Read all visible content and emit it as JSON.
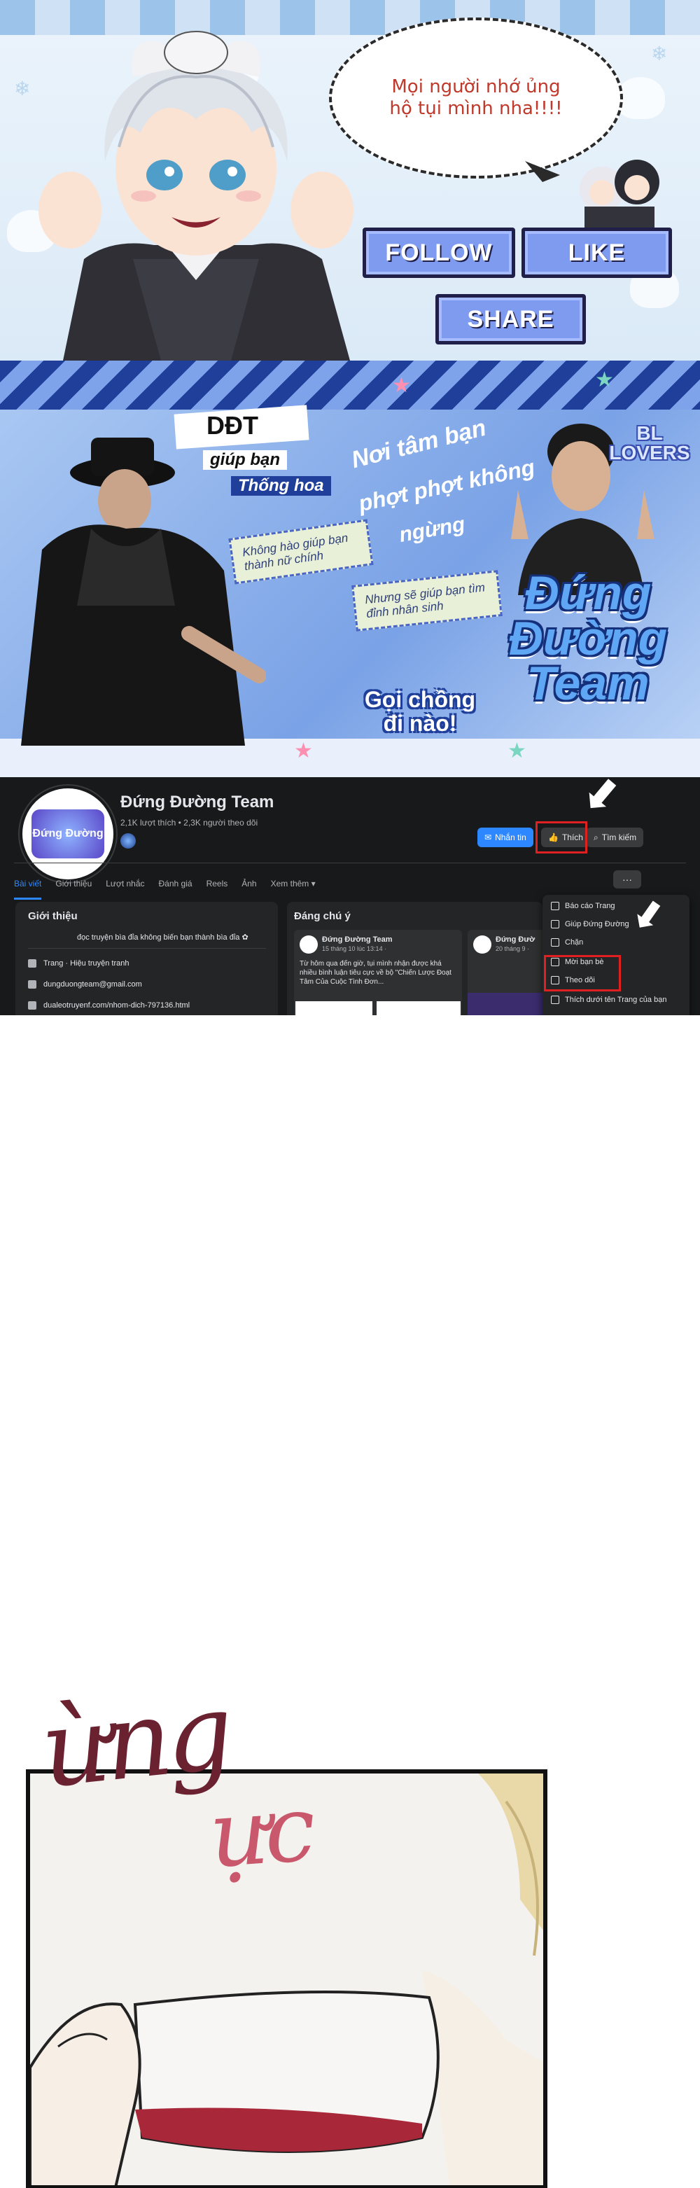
{
  "banner1": {
    "speech": "Mọi người nhớ ủng hộ tụi mình nha!!!!",
    "buttons": {
      "follow": "FOLLOW",
      "like": "LIKE",
      "share": "SHARE"
    }
  },
  "banner2": {
    "tag1": "DĐT",
    "tag2": "giúp bạn",
    "tag3": "Thống hoa",
    "script1": "Nơi tâm bạn",
    "script2": "phợt phợt không",
    "script3": "ngừng",
    "note1": "Không hào giúp bạn thành nữ chính",
    "note2": "Nhưng sẽ giúp bạn tìm đỉnh nhân sinh",
    "bl": "BL LOVERS",
    "title": "Đứng Đường Team",
    "call": "Gọi chồng đi nào!"
  },
  "fb": {
    "avatar_text": "Đứng Đường",
    "name": "Đứng Đường Team",
    "stats": "2,1K lượt thích • 2,3K người theo dõi",
    "buttons": {
      "message": "Nhắn tin",
      "like": "Thích",
      "search": "Tìm kiếm"
    },
    "tabs": [
      "Bài viết",
      "Giới thiệu",
      "Lượt nhắc",
      "Đánh giá",
      "Reels",
      "Ảnh",
      "Xem thêm ▾"
    ],
    "more": "···",
    "intro": {
      "title": "Giới thiệu",
      "desc": "đọc truyện bìa đỉa không biến bạn thành bìa đỉa ✿",
      "lines": [
        "Trang · Hiệu truyện tranh",
        "dungduongteam@gmail.com",
        "dualeotruyenf.com/nhom-dich-797136.html"
      ]
    },
    "featured": {
      "title": "Đáng chú ý",
      "post1": {
        "author": "Đứng Đường Team",
        "date": "15 tháng 10 lúc 13:14 ·",
        "text": "Từ hôm qua đến giờ, tụi mình nhận được khá nhiều bình luận tiêu cực về bộ \"Chiến Lược Đoạt Tâm Của Cuộc Tình Đơn..."
      },
      "post2": {
        "author": "Đứng Đườ",
        "date": "20 tháng 9 ·"
      }
    },
    "menu": [
      "Báo cáo Trang",
      "Giúp Đứng Đường",
      "Chặn",
      "Mời bạn bè",
      "Theo dõi",
      "Thích dưới tên Trang của bạn"
    ]
  },
  "comic": {
    "sfx1": "ừng",
    "sfx2": "ực"
  }
}
